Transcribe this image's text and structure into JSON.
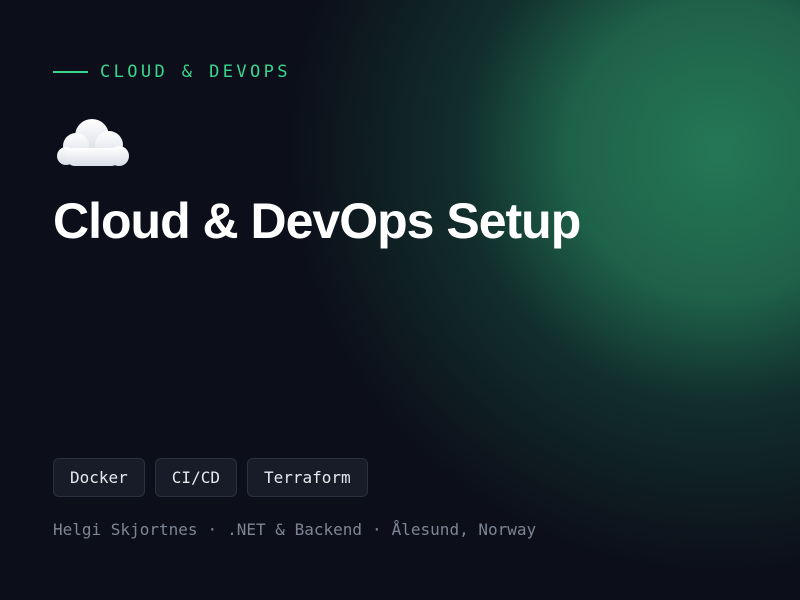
{
  "eyebrow": "CLOUD & DEVOPS",
  "hero_icon": "cloud-icon",
  "title": "Cloud & DevOps Setup",
  "tags": [
    "Docker",
    "CI/CD",
    "Terraform"
  ],
  "footer": {
    "name": "Helgi Skjortnes",
    "role": ".NET & Backend",
    "location": "Ålesund, Norway",
    "separator": "·"
  },
  "colors": {
    "background": "#0c0f1a",
    "accent": "#3ad68f",
    "glow": "#267d5a",
    "title": "#ffffff",
    "tag_background": "#181c28",
    "muted_text": "#7d8494"
  }
}
